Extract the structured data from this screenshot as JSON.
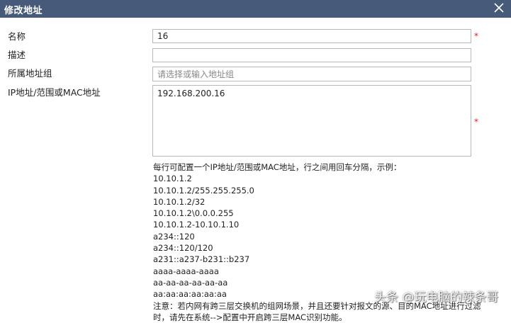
{
  "dialog": {
    "title": "修改地址",
    "close_icon": "close-icon"
  },
  "form": {
    "name": {
      "label": "名称",
      "value": "16",
      "required_mark": "*"
    },
    "description": {
      "label": "描述",
      "value": ""
    },
    "group": {
      "label": "所属地址组",
      "placeholder": "请选择或输入地址组"
    },
    "address": {
      "label": "IP地址/范围或MAC地址",
      "value": "192.168.200.16",
      "required_mark": "*"
    }
  },
  "help": {
    "intro": "每行可配置一个IP地址/范围或MAC地址，行之间用回车分隔，示例：",
    "examples": [
      "10.10.1.2",
      "10.10.1.2/255.255.255.0",
      "10.10.1.2/32",
      "10.10.1.2\\0.0.0.255",
      "10.10.1.2-10.10.1.10",
      "a234::120",
      "a234::120/120",
      "a231::a237-b231::b237",
      "aaaa-aaaa-aaaa",
      "aa-aa-aa-aa-aa-aa",
      "aa:aa:aa:aa:aa:aa"
    ],
    "note": "注意：若内网有跨三层交换机的组网场景，并且还要针对报文的源、目的MAC地址进行过滤时，请先在系统-->配置中开启跨三层MAC识别功能。"
  },
  "watermark": "头条 @玩电脑的辣条哥"
}
